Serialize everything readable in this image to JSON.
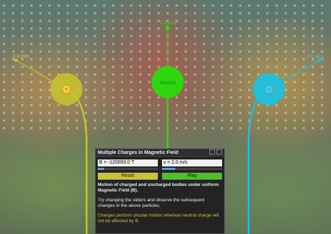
{
  "scene": {
    "charges": [
      {
        "name": "positive",
        "symbol": "+",
        "velocity": "2.0 m/s",
        "color": "#c7c52c"
      },
      {
        "name": "neutral",
        "label": "Neutral",
        "velocity": "2.0 m/s",
        "color": "#2fd60f"
      },
      {
        "name": "negative",
        "symbol": "−",
        "velocity": "2.0 m/s",
        "color": "#15c3e6"
      }
    ]
  },
  "panel": {
    "title": "Multiple Charges in Magnetic Field",
    "b_field": "B = -120000.0 T",
    "velocity": "v = 2.0 m/s",
    "b_slider_fraction": 0.1,
    "v_slider_fraction": 0.22,
    "reset_label": "Reset",
    "play_label": "Play",
    "info_heading": "Motion of charged and uncharged bodies under uniform Magnetic Field (B).",
    "info_body": "Try changing the sliders and observe the subsequent changes in the above particles.",
    "info_note": "Charges perform circular motion whereas neutral charge will not be affected by B."
  }
}
